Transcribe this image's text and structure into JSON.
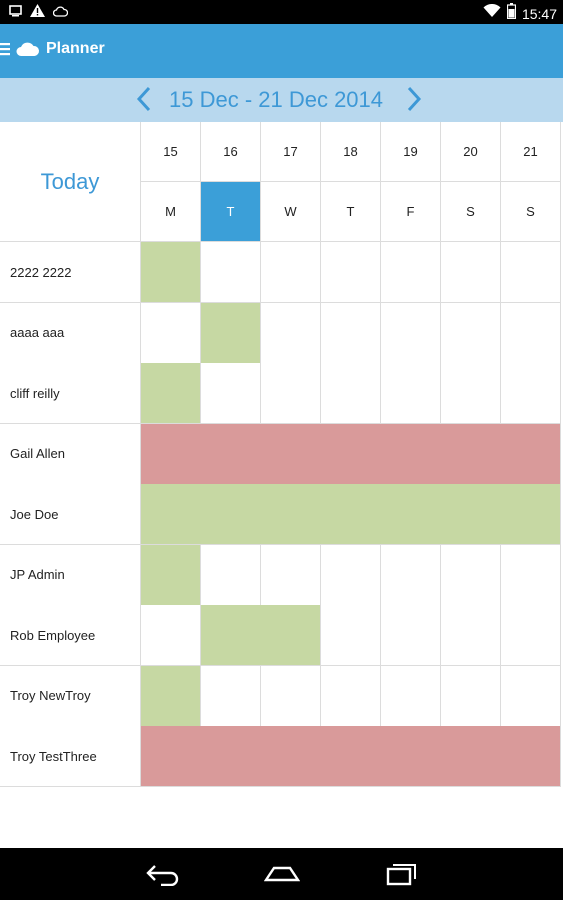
{
  "status_bar": {
    "time": "15:47",
    "left_icons": [
      "screenshot-icon",
      "warning-icon",
      "cloud-outline-icon"
    ],
    "right_icons": [
      "wifi-icon",
      "battery-icon"
    ]
  },
  "app_bar": {
    "title": "Planner",
    "icons": [
      "menu-icon",
      "cloud-icon"
    ]
  },
  "week_header": {
    "range": "15 Dec  - 21 Dec 2014",
    "icons": [
      "chevron-left-icon",
      "chevron-right-icon"
    ]
  },
  "today_label": "Today",
  "days": [
    {
      "num": "15",
      "letter": "M"
    },
    {
      "num": "16",
      "letter": "T"
    },
    {
      "num": "17",
      "letter": "W"
    },
    {
      "num": "18",
      "letter": "T"
    },
    {
      "num": "19",
      "letter": "F"
    },
    {
      "num": "20",
      "letter": "S"
    },
    {
      "num": "21",
      "letter": "S"
    }
  ],
  "selected_day_index": 1,
  "people": [
    {
      "name": "2222 2222",
      "bookings": [
        {
          "start": 0,
          "days": 1,
          "color": "#c6d8a3"
        }
      ]
    },
    {
      "name": "aaaa aaa",
      "bookings": [
        {
          "start": 1,
          "days": 1,
          "color": "#c6d8a3"
        }
      ]
    },
    {
      "name": "cliff reilly",
      "bookings": [
        {
          "start": 0,
          "days": 1,
          "color": "#c6d8a3"
        }
      ]
    },
    {
      "name": "Gail Allen",
      "bookings": [
        {
          "start": 0,
          "days": 7,
          "color": "#d99a9a"
        }
      ]
    },
    {
      "name": "Joe Doe",
      "bookings": [
        {
          "start": 0,
          "days": 7,
          "color": "#c6d8a3"
        }
      ]
    },
    {
      "name": "JP Admin",
      "bookings": [
        {
          "start": 0,
          "days": 1,
          "color": "#c6d8a3"
        }
      ]
    },
    {
      "name": "Rob Employee",
      "bookings": [
        {
          "start": 1,
          "days": 2,
          "color": "#c6d8a3"
        }
      ]
    },
    {
      "name": "Troy NewTroy",
      "bookings": [
        {
          "start": 0,
          "days": 1,
          "color": "#c6d8a3"
        }
      ]
    },
    {
      "name": "Troy TestThree",
      "bookings": [
        {
          "start": 0,
          "days": 7,
          "color": "#d99a9a"
        }
      ]
    }
  ],
  "colors": {
    "accent": "#3b9fd8",
    "week_bar": "#b8d8ee",
    "booked": "#c6d8a3",
    "absence": "#d99a9a"
  },
  "nav_bar": {
    "icons": [
      "back-icon",
      "home-icon",
      "recents-icon"
    ]
  }
}
